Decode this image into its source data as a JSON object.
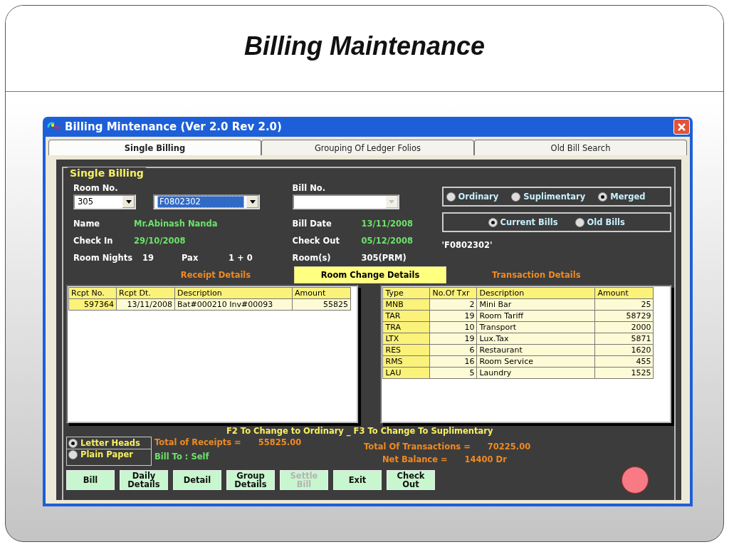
{
  "slide_title": "Billing Maintenance",
  "window": {
    "title": "Billing Mintenance (Ver 2.0 Rev 2.0)"
  },
  "tabs": [
    {
      "label": "Single Billing",
      "selected": true
    },
    {
      "label": "Grouping Of Ledger Folios",
      "selected": false
    },
    {
      "label": "Old Bill Search",
      "selected": false
    }
  ],
  "group_title": "Single Billing",
  "room_no": {
    "label": "Room No.",
    "value": "305"
  },
  "folio": {
    "value": "F0802302",
    "selected": true
  },
  "bill_no": {
    "label": "Bill No.",
    "disabled": true
  },
  "bill_type": [
    {
      "label": "Ordinary",
      "selected": false
    },
    {
      "label": "Suplimentary",
      "selected": false
    },
    {
      "label": "Merged",
      "selected": true
    }
  ],
  "bill_period": [
    {
      "label": "Current Bills",
      "selected": true
    },
    {
      "label": "Old Bills",
      "selected": false
    }
  ],
  "left_rows": [
    {
      "items": [
        {
          "label": "Name",
          "value": "Mr.Abinash Nanda"
        }
      ]
    },
    {
      "items": [
        {
          "label": "Check In",
          "value": "29/10/2008"
        }
      ]
    },
    {
      "items": [
        {
          "label": "Room Nights",
          "value": "19"
        },
        {
          "label": "Pax",
          "value": "1 + 0"
        }
      ]
    }
  ],
  "right_rows": [
    {
      "label": "Bill Date",
      "value": "13/11/2008",
      "kind": "green"
    },
    {
      "label": "Check Out",
      "value": "05/12/2008",
      "kind": "green"
    },
    {
      "label": "Room(s)",
      "value": "305(PRM)",
      "kind": "white"
    }
  ],
  "quoted_folio": "'F0802302'",
  "receipt_title": "Receipt Details",
  "room_change_button": "Room Change Details",
  "transaction_title": "Transaction Details",
  "receipts": {
    "columns": [
      "Rcpt No.",
      "Rcpt Dt.",
      "Description",
      "Amount"
    ],
    "rows": [
      [
        "597364",
        "13/11/2008",
        "Bat#000210  Inv#00093",
        "55825"
      ]
    ]
  },
  "transactions": {
    "columns": [
      "Type",
      "No.Of Txr",
      "Description",
      "Amount"
    ],
    "rows": [
      [
        "MNB",
        "2",
        "Mini Bar",
        "25"
      ],
      [
        "TAR",
        "19",
        "Room Tariff",
        "58729"
      ],
      [
        "TRA",
        "10",
        "Transport",
        "2000"
      ],
      [
        "LTX",
        "19",
        "Lux.Tax",
        "5871"
      ],
      [
        "RES",
        "6",
        "Restaurant",
        "1620"
      ],
      [
        "RMS",
        "16",
        "Room Service",
        "455"
      ],
      [
        "LAU",
        "5",
        "Laundry",
        "1525"
      ]
    ]
  },
  "hint": "F2 To Change to Ordinary _ F3 To Change To Suplimentary",
  "print_mode": [
    {
      "label": "Letter Heads",
      "selected": true
    },
    {
      "label": "Plain Paper",
      "selected": false
    }
  ],
  "total_receipts": {
    "label": "Total of Receipts =",
    "value": "55825.00"
  },
  "bill_to": "Bill To : Self",
  "total_transactions": {
    "label": "Total Of Transactions =",
    "value": "70225.00"
  },
  "net_balance": {
    "label": "Net Balance =",
    "value": "14400 Dr"
  },
  "buttons": [
    {
      "label": "Bill",
      "disabled": false
    },
    {
      "label": "Daily\nDetails",
      "disabled": false
    },
    {
      "label": "Detail",
      "disabled": false
    },
    {
      "label": "Group\nDetails",
      "disabled": false
    },
    {
      "label": "Settle\nBill",
      "disabled": true
    },
    {
      "label": "Exit",
      "disabled": false
    },
    {
      "label": "Check\nOut",
      "disabled": false
    }
  ]
}
